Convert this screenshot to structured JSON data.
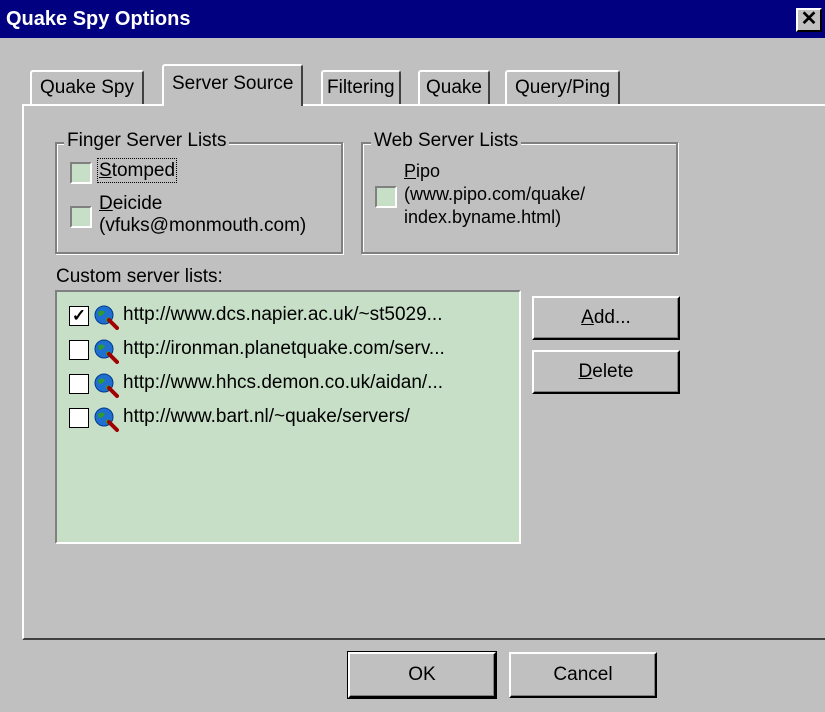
{
  "window": {
    "title": "Quake Spy Options",
    "close_glyph": "✕"
  },
  "tabs": [
    {
      "label": "Quake Spy",
      "active": false
    },
    {
      "label": "Server Source",
      "active": true
    },
    {
      "label": "Filtering",
      "active": false
    },
    {
      "label": "Quake",
      "active": false
    },
    {
      "label": "Query/Ping",
      "active": false
    }
  ],
  "finger_group": {
    "legend": "Finger Server Lists",
    "stomped": {
      "mnemonic": "S",
      "rest": "tomped",
      "checked": false
    },
    "deicide": {
      "mnemonic": "D",
      "rest": "eicide",
      "line2": "(vfuks@monmouth.com)",
      "checked": false
    }
  },
  "web_group": {
    "legend": "Web Server Lists",
    "pipo": {
      "mnemonic": "P",
      "rest": "ipo",
      "line2": "(www.pipo.com/quake/",
      "line3": "index.byname.html)",
      "checked": false
    }
  },
  "custom": {
    "label": "Custom server lists:",
    "items": [
      {
        "url": "http://www.dcs.napier.ac.uk/~st5029...",
        "checked": true,
        "check_glyph": "✓"
      },
      {
        "url": "http://ironman.planetquake.com/serv...",
        "checked": false,
        "check_glyph": ""
      },
      {
        "url": "http://www.hhcs.demon.co.uk/aidan/...",
        "checked": false,
        "check_glyph": ""
      },
      {
        "url": "http://www.bart.nl/~quake/servers/",
        "checked": false,
        "check_glyph": ""
      }
    ],
    "icon": "globe-magnifier-icon"
  },
  "buttons": {
    "add": {
      "mnemonic": "A",
      "rest": "dd..."
    },
    "delete": {
      "mnemonic": "D",
      "rest": "elete"
    },
    "ok": "OK",
    "cancel": "Cancel"
  },
  "colors": {
    "titlebar": "#000080",
    "face": "#c0c0c0",
    "field": "#c7dfc7"
  }
}
